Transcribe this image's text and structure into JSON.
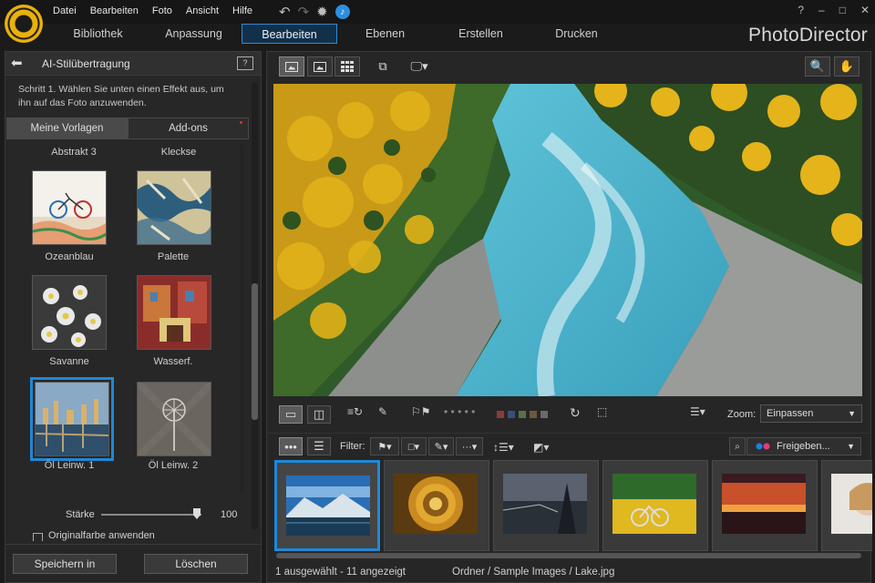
{
  "menu": [
    "Datei",
    "Bearbeiten",
    "Foto",
    "Ansicht",
    "Hilfe"
  ],
  "window_controls": {
    "help": "?",
    "minimize": "–",
    "maximize": "□",
    "close": "✕"
  },
  "tabs": [
    {
      "label": "Bibliothek",
      "active": false
    },
    {
      "label": "Anpassung",
      "active": false
    },
    {
      "label": "Bearbeiten",
      "active": true
    },
    {
      "label": "Ebenen",
      "active": false
    },
    {
      "label": "Erstellen",
      "active": false
    },
    {
      "label": "Drucken",
      "active": false
    }
  ],
  "brand": "PhotoDirector",
  "left_panel": {
    "title": "AI-Stilübertragung",
    "help_icon": "?",
    "step_text": "Schritt 1. Wählen Sie unten einen Effekt aus, um ihn auf das Foto anzuwenden.",
    "subtabs": [
      "Meine Vorlagen",
      "Add-ons"
    ],
    "top_captions": [
      "Abstrakt 3",
      "Kleckse"
    ],
    "effects": [
      {
        "label": "Ozeanblau",
        "selected": false
      },
      {
        "label": "Palette",
        "selected": false
      },
      {
        "label": "Savanne",
        "selected": false
      },
      {
        "label": "Wasserf.",
        "selected": false
      },
      {
        "label": "Öl Leinw. 1",
        "selected": true
      },
      {
        "label": "Öl Leinw. 2",
        "selected": false
      }
    ],
    "strength_label": "Stärke",
    "strength_value": "100",
    "original_color_label": "Originalfarbe anwenden",
    "save_button": "Speichern in",
    "delete_button": "Löschen"
  },
  "workspace": {
    "zoom_label": "Zoom:",
    "zoom_value": "Einpassen",
    "filter_label": "Filter:",
    "share_label": "Freigeben...",
    "toolbar_dots": "• • • • •",
    "color_labels": [
      "#8b3a3a",
      "#3a4f78",
      "#5a6f4a",
      "#6a5a3a",
      "#6a6a6a"
    ],
    "status_count": "1 ausgewählt - 11 angezeigt",
    "status_path": "Ordner / Sample Images / Lake.jpg"
  },
  "filmstrip": [
    {
      "name": "lake-mountains",
      "selected": true
    },
    {
      "name": "spiral-stairs",
      "selected": false
    },
    {
      "name": "coastal-village",
      "selected": false
    },
    {
      "name": "bicycle-field",
      "selected": false
    },
    {
      "name": "sunset-sea",
      "selected": false
    },
    {
      "name": "portrait-partial",
      "selected": false
    }
  ]
}
